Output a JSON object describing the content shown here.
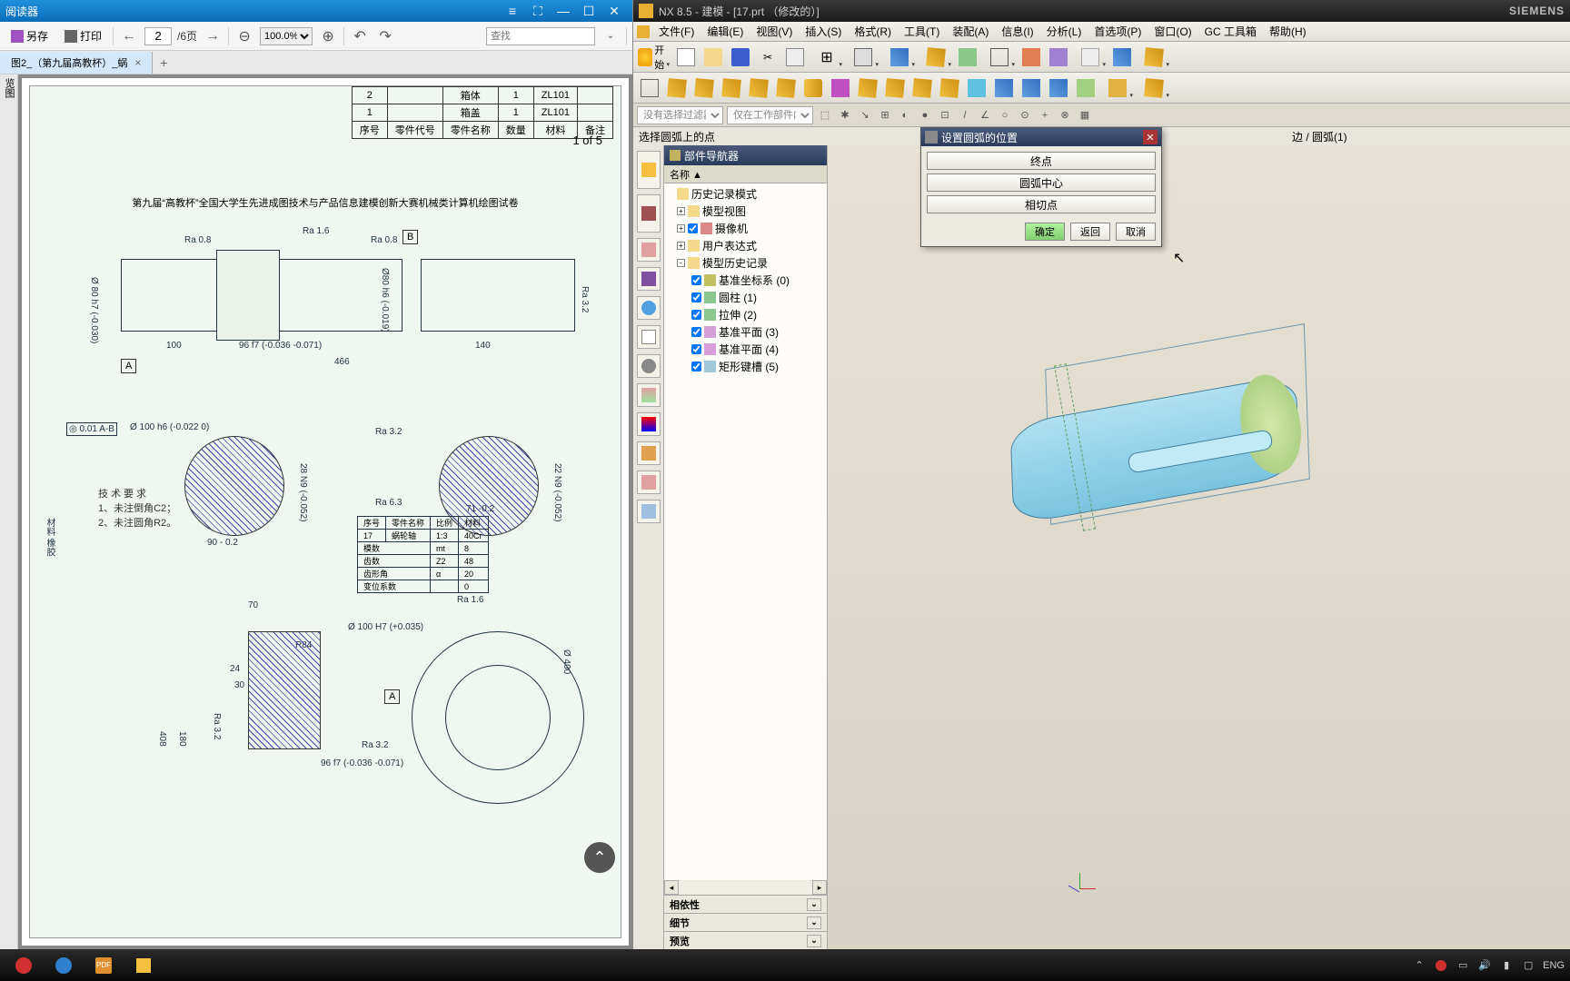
{
  "pdf": {
    "title": "阅读器",
    "toolbar": {
      "save_as": "另存",
      "print": "打印",
      "page_input": "2",
      "page_total": "/6页",
      "zoom": "100.0%",
      "search_placeholder": "查找"
    },
    "tab": "图2_（第九届高教杯）_蜗",
    "sidebar": "览图",
    "page_indicator": "1 of 5",
    "drawing_heading": "第九届“高教杯”全国大学生先进成图技术与产品信息建模创新大赛机械类计算机绘图试卷",
    "bom": [
      [
        "2",
        "",
        "箱体",
        "1",
        "ZL101",
        ""
      ],
      [
        "1",
        "",
        "箱盖",
        "1",
        "ZL101",
        ""
      ],
      [
        "序号",
        "零件代号",
        "零件名称",
        "数量",
        "材料",
        "备注"
      ]
    ],
    "sections": {
      "a": "A",
      "b": "B"
    },
    "gd_t": "◎ 0.01 A-B",
    "dims": {
      "ra16": "Ra 1.6",
      "ra08": "Ra 0.8",
      "ra08b": "Ra 0.8",
      "ra32": "Ra 3.2",
      "d80": "Ø 80 h7 (-0.030)",
      "d80b": "Ø80 h6 (-0.019)",
      "l100": "100",
      "l96": "96 f7 (-0.036 -0.071)",
      "l140": "140",
      "l466": "466",
      "d100": "Ø 100 h6 (-0.022 0)",
      "w28": "28 N9 (-0.052)",
      "w22": "22 N9 (-0.052)",
      "r32_v": "Ra 3.2",
      "ra63": "Ra 6.3",
      "w71": "71 -0.2",
      "w90": "90 - 0.2",
      "d100h7": "Ø 100 H7 (+0.035)",
      "l96b": "96 f7 (-0.036 -0.071)",
      "d400": "Ø 400",
      "r84": "R84",
      "l24": "24",
      "l30": "30",
      "l70": "70",
      "a180": "180",
      "a408": "408",
      "ra32c": "Ra 3.2",
      "ra16b": "Ra 1.6",
      "ra32d": "Ra 3.2"
    },
    "tech": {
      "title": "技术要求",
      "l1": "1、未注倒角C2；",
      "l2": "2、未注圆角R2。"
    },
    "spec_table": {
      "r1": [
        "序号",
        "零件名称",
        "比例",
        "材料"
      ],
      "r2": [
        "17",
        "蜗轮轴",
        "1:3",
        "40Cr"
      ],
      "r3": [
        "模数",
        "mt",
        "8"
      ],
      "r4": [
        "齿数",
        "Z2",
        "48"
      ],
      "r5": [
        "齿形角",
        "α",
        "20"
      ],
      "r6": [
        "变位系数",
        "",
        "0"
      ]
    },
    "mat_label": "材料 橡胶"
  },
  "nx": {
    "title": "NX 8.5 - 建模 - [17.prt （修改的）]",
    "brand": "SIEMENS",
    "menu": [
      "文件(F)",
      "编辑(E)",
      "视图(V)",
      "插入(S)",
      "格式(R)",
      "工具(T)",
      "装配(A)",
      "信息(I)",
      "分析(L)",
      "首选项(P)",
      "窗口(O)",
      "GC 工具箱",
      "帮助(H)"
    ],
    "start": "开始",
    "sel1": "没有选择过滤器",
    "sel2": "仅在工作部件内",
    "prompt_left": "选择圆弧上的点",
    "prompt_right": "边 / 圆弧(1)",
    "nav_title": "部件导航器",
    "nav_header": "名称 ▲",
    "tree": [
      {
        "label": "历史记录模式",
        "lvl": 1,
        "exp": ""
      },
      {
        "label": "模型视图",
        "lvl": 1,
        "exp": "+"
      },
      {
        "label": "摄像机",
        "lvl": 1,
        "exp": "+",
        "chk": true
      },
      {
        "label": "用户表达式",
        "lvl": 1,
        "exp": "+"
      },
      {
        "label": "模型历史记录",
        "lvl": 1,
        "exp": "-"
      },
      {
        "label": "基准坐标系 (0)",
        "lvl": 2,
        "chk": true
      },
      {
        "label": "圆柱 (1)",
        "lvl": 2,
        "chk": true
      },
      {
        "label": "拉伸 (2)",
        "lvl": 2,
        "chk": true
      },
      {
        "label": "基准平面 (3)",
        "lvl": 2,
        "chk": true
      },
      {
        "label": "基准平面 (4)",
        "lvl": 2,
        "chk": true
      },
      {
        "label": "矩形键槽 (5)",
        "lvl": 2,
        "chk": true
      }
    ],
    "sections": {
      "dep": "相依性",
      "detail": "细节",
      "preview": "预览"
    },
    "dialog": {
      "title": "设置圆弧的位置",
      "opt1": "终点",
      "opt2": "圆弧中心",
      "opt3": "相切点",
      "ok": "确定",
      "back": "返回",
      "cancel": "取消"
    }
  },
  "tray": {
    "lang": "ENG"
  }
}
